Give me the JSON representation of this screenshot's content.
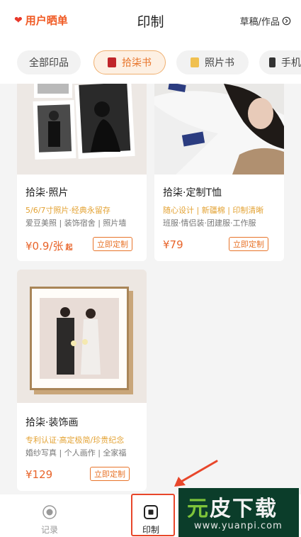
{
  "header": {
    "showcase_label": "用户晒单",
    "title": "印制",
    "drafts_label": "草稿/作品"
  },
  "tabs": [
    {
      "label": "全部印品"
    },
    {
      "label": "拾柒书"
    },
    {
      "label": "照片书"
    },
    {
      "label": "手机"
    }
  ],
  "products": [
    {
      "name": "拾柒·照片",
      "tagline": "5/6/7寸照片·经典永留存",
      "tags": "爱豆美照 | 装饰宿舍 | 照片墙",
      "price": "¥0.9/张",
      "price_suffix": "起",
      "button": "立即定制"
    },
    {
      "name": "拾柒·定制T恤",
      "tagline": "随心设计 | 新疆棉 | 印制清晰",
      "tags": "班服·情侣装·团建服·工作服",
      "price": "¥79",
      "price_suffix": "",
      "button": "立即定制"
    },
    {
      "name": "拾柒·装饰画",
      "tagline": "专利认证·高定极简/珍贵纪念",
      "tags": "婚纱写真 | 个人画作 | 全家福",
      "price": "¥129",
      "price_suffix": "",
      "button": "立即定制"
    }
  ],
  "bottom_nav": [
    {
      "label": "记录"
    },
    {
      "label": "印制"
    }
  ],
  "watermark": {
    "text_a": "元",
    "text_b": "皮下载",
    "url": "www.yuanpi.com"
  },
  "colors": {
    "accent": "#e8742a",
    "heart": "#e8382a",
    "tagline": "#e3a233",
    "highlight": "#e8462a"
  }
}
